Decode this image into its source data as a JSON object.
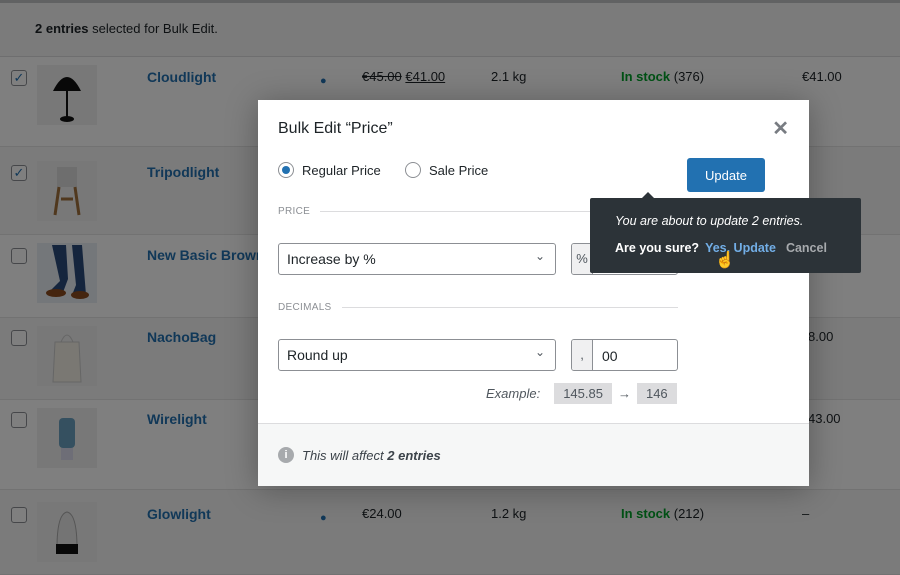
{
  "notice": {
    "count": "2 entries",
    "text": " selected for Bulk Edit."
  },
  "rows": [
    {
      "checked": true,
      "name": "Cloudlight",
      "regular": "€45.00",
      "sale": "€41.00",
      "weight": "2.1 kg",
      "stock_label": "In stock",
      "stock_count": " (376)",
      "last": "€41.00"
    },
    {
      "checked": true,
      "name": "Tripodlight"
    },
    {
      "checked": false,
      "name": "New Basic Brown"
    },
    {
      "checked": false,
      "name": "NachoBag",
      "last": "8.00"
    },
    {
      "checked": false,
      "name": "Wirelight",
      "last": "43.00"
    },
    {
      "checked": false,
      "name": "Glowlight",
      "price": "€24.00",
      "weight": "1.2 kg",
      "stock_label": "In stock",
      "stock_count": " (212)",
      "last": "–"
    }
  ],
  "modal": {
    "title": "Bulk Edit “Price”",
    "radios": [
      {
        "label": "Regular Price",
        "selected": true
      },
      {
        "label": "Sale Price",
        "selected": false
      }
    ],
    "update_label": "Update",
    "price_section": "PRICE",
    "price_mode": "Increase by %",
    "price_prefix": "%",
    "decimals_section": "DECIMALS",
    "rounding": "Round up",
    "decimal_sep": ",",
    "decimal_value": "00",
    "example_label": "Example:",
    "example_from": "145.85",
    "example_arrow": "→",
    "example_to": "146",
    "footer_pre": "This will affect ",
    "footer_count": "2 entries"
  },
  "confirm": {
    "message": "You are about to update 2 entries.",
    "question": "Are you sure?",
    "yes": "Yes, Update",
    "cancel": "Cancel"
  },
  "colors": {
    "accent": "#2271b1",
    "in_stock": "#00a32a",
    "tooltip": "#2c3338"
  }
}
